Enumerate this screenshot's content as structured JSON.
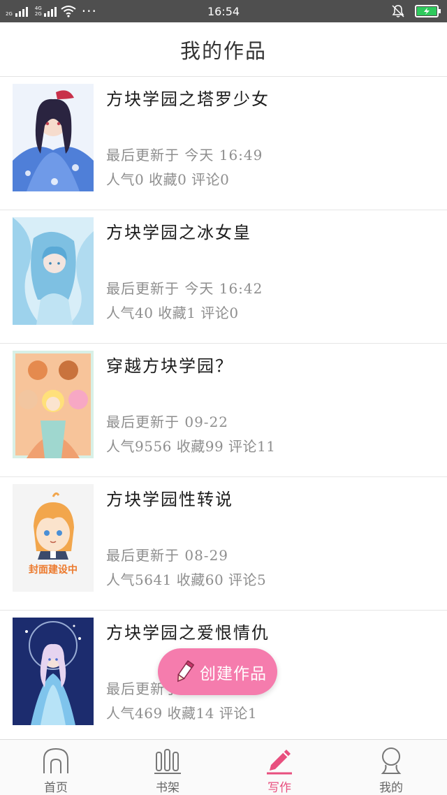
{
  "status_bar": {
    "network_1": "2G",
    "network_2a": "4G",
    "network_2b": "2G",
    "more": "···",
    "time": "16:54"
  },
  "header": {
    "title": "我的作品"
  },
  "works": [
    {
      "title": "方块学园之塔罗少女",
      "updated": "最后更新于 今天 16:49",
      "stats": "人气0 收藏0 评论0"
    },
    {
      "title": "方块学园之冰女皇",
      "updated": "最后更新于 今天 16:42",
      "stats": "人气40 收藏1 评论0"
    },
    {
      "title": "穿越方块学园？",
      "updated": "最后更新于 09-22",
      "stats": "人气9556 收藏99 评论11"
    },
    {
      "title": "方块学园性转说",
      "updated": "最后更新于 08-29",
      "stats": "人气5641 收藏60 评论5",
      "cover_text": "封面建设中"
    },
    {
      "title": "方块学园之爱恨情仇",
      "updated": "最后更新于",
      "stats": "人气469 收藏14 评论1"
    }
  ],
  "create_button": {
    "label": "创建作品"
  },
  "bottom_nav": {
    "items": [
      {
        "label": "首页",
        "icon": "home-icon"
      },
      {
        "label": "书架",
        "icon": "bookshelf-icon"
      },
      {
        "label": "写作",
        "icon": "pencil-icon",
        "active": true
      },
      {
        "label": "我的",
        "icon": "profile-icon"
      }
    ]
  },
  "colors": {
    "accent": "#e84f7e",
    "create_button": "#f57cad",
    "status_bar": "#4f4f4f",
    "battery": "#2ec95c"
  }
}
